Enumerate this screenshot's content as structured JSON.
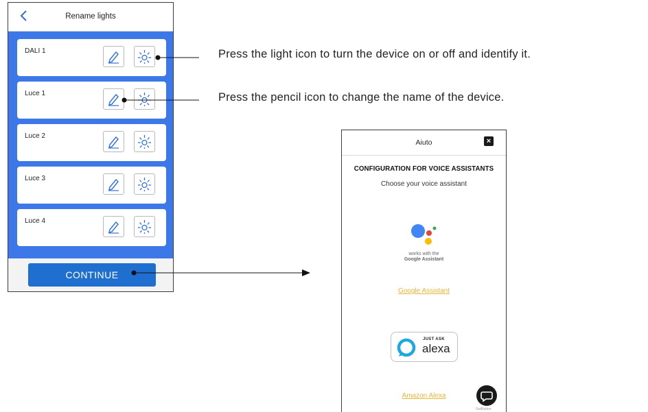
{
  "rename_screen": {
    "title": "Rename lights",
    "devices": [
      {
        "label": "DALI 1"
      },
      {
        "label": "Luce 1"
      },
      {
        "label": "Luce 2"
      },
      {
        "label": "Luce 3"
      },
      {
        "label": "Luce 4"
      }
    ],
    "continue_label": "CONTINUE",
    "colors": {
      "list_bg": "#3d78e8",
      "button": "#1f6fd1",
      "icon": "#2d6fe0"
    }
  },
  "annotations": {
    "light_icon_note": "Press the light icon to turn the device on or off and identify it.",
    "pencil_icon_note": "Press the pencil icon to change the name of the device."
  },
  "help_screen": {
    "title": "Aiuto",
    "close_icon": "close-icon",
    "heading": "CONFIGURATION FOR VOICE ASSISTANTS",
    "subheading": "Choose your voice assistant",
    "google_caption_line1": "works with the",
    "google_caption_line2": "Google Assistant",
    "google_link": "Google Assistant",
    "alexa_small": "JUST ASK",
    "alexa_word": "alexa",
    "amazon_link": "Amazon Alexa",
    "chat_caption": "GetButton",
    "colors": {
      "link": "#e8b43a"
    }
  }
}
